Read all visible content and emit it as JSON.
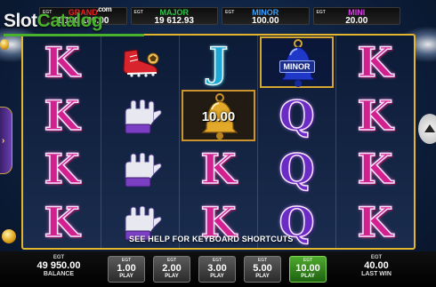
{
  "watermark": {
    "slot": "Slot",
    "catalog": "Catalog",
    "suffix": ".com"
  },
  "jackpots": [
    {
      "name": "GRAND",
      "value": "1 100 100.00",
      "color": "#e32424"
    },
    {
      "name": "MAJOR",
      "value": "19 612.93",
      "color": "#2fc24a"
    },
    {
      "name": "MINOR",
      "value": "100.00",
      "color": "#3aa0ff"
    },
    {
      "name": "MINI",
      "value": "20.00",
      "color": "#d33fe0"
    }
  ],
  "egt_label": "EGT",
  "reels": [
    [
      "K",
      "K",
      "K",
      "K"
    ],
    [
      "boot",
      "glove",
      "glove",
      "glove"
    ],
    [
      "J",
      "bell",
      "K",
      "K"
    ],
    [
      "bell",
      "Q",
      "Q",
      "Q"
    ],
    [
      "K",
      "K",
      "K",
      "K"
    ]
  ],
  "bell_bonus": {
    "value": "10.00"
  },
  "bell_jackpot": {
    "tag": "MINOR"
  },
  "help_text": "SEE HELP FOR KEYBOARD SHORTCUTS",
  "balance": {
    "value": "49 950.00",
    "label": "BALANCE"
  },
  "bets": [
    {
      "value": "1.00",
      "label": "PLAY",
      "active": false
    },
    {
      "value": "2.00",
      "label": "PLAY",
      "active": false
    },
    {
      "value": "3.00",
      "label": "PLAY",
      "active": false
    },
    {
      "value": "5.00",
      "label": "PLAY",
      "active": false
    },
    {
      "value": "10.00",
      "label": "PLAY",
      "active": true
    }
  ],
  "last_win": {
    "value": "40.00",
    "label": "LAST WIN"
  }
}
